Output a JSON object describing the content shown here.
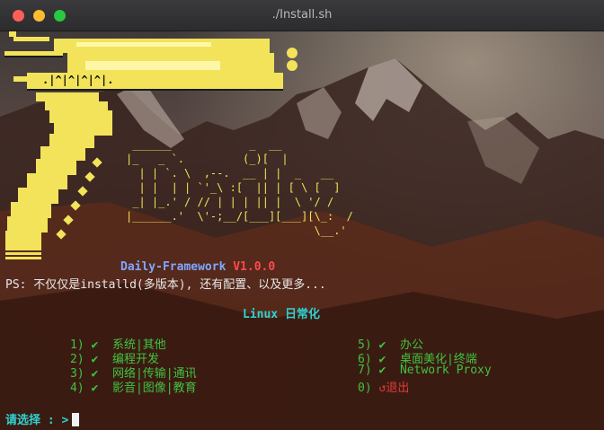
{
  "window": {
    "title": "./Install.sh"
  },
  "logo": {
    "ascii": [
      " ______            _  __",
      "|_   _ `.         (_)[  |",
      "  | | `. \\  ,--.  __ | |  _   __",
      "  | |  | | `'_\\ :[  || | [ \\ [  ]",
      " _| |_.' / // | | | || |  \\ '/ /",
      "|______.'  \\'-;__/[___][___][\\_:  /",
      "                             \\__.'"
    ],
    "gun_text": ".|^|^|^|^|."
  },
  "brand": {
    "name": "Daily-Framework",
    "version": "V1.0.0"
  },
  "tagline": "PS: 不仅仅是installd(多版本), 还有配置、以及更多...",
  "menu_title": "Linux 日常化",
  "menu": {
    "left": [
      {
        "num": "1)",
        "check": "✔",
        "label": "系统|其他"
      },
      {
        "num": "2)",
        "check": "✔",
        "label": "编程开发"
      },
      {
        "num": "3)",
        "check": "✔",
        "label": "网络|传输|通讯"
      },
      {
        "num": "4)",
        "check": "✔",
        "label": "影音|图像|教育"
      }
    ],
    "right": [
      {
        "num": "5)",
        "check": "✔",
        "label": "办公"
      },
      {
        "num": "6)",
        "check": "✔",
        "label": "桌面美化|终端"
      },
      {
        "num": "7)",
        "check": "✔",
        "label": "Network Proxy"
      },
      {
        "num": "0)",
        "check": "↺",
        "label": "退出"
      }
    ]
  },
  "prompt": "请选择 : >",
  "colors": {
    "logo": "#f2e35a",
    "brand": "#7fa7ff",
    "version": "#ff4a4a",
    "menu": "#41c241",
    "exit": "#e23b3b",
    "accent": "#2fd2d2"
  }
}
